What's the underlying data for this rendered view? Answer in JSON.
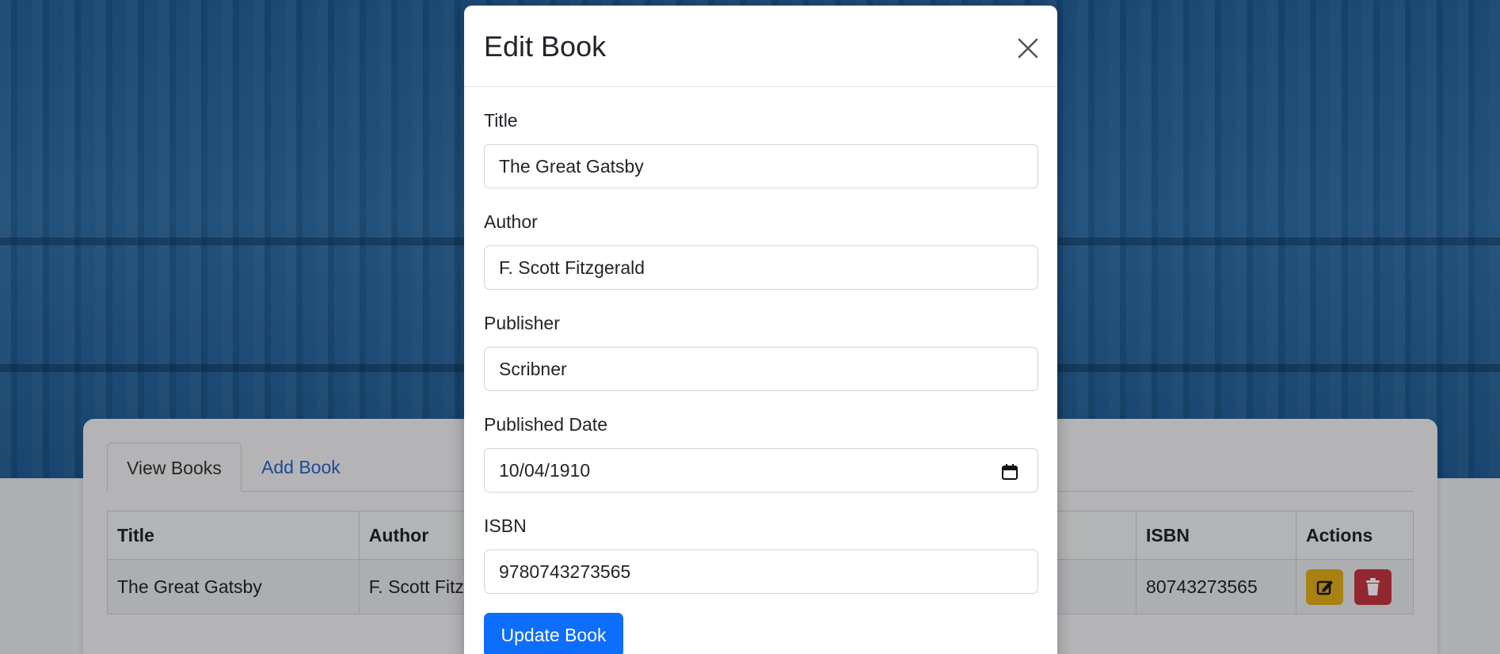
{
  "page": {
    "tabs": [
      {
        "label": "View Books"
      },
      {
        "label": "Add Book"
      }
    ],
    "table": {
      "headers": [
        "Title",
        "Author",
        "",
        "",
        "ISBN",
        "Actions"
      ],
      "rows": [
        {
          "title": "The Great Gatsby",
          "author": "F. Scott Fitz",
          "isbn_visible": "80743273565"
        }
      ]
    }
  },
  "modal": {
    "title": "Edit Book",
    "fields": {
      "title": {
        "label": "Title",
        "value": "The Great Gatsby"
      },
      "author": {
        "label": "Author",
        "value": "F. Scott Fitzgerald"
      },
      "publisher": {
        "label": "Publisher",
        "value": "Scribner"
      },
      "published_date": {
        "label": "Published Date",
        "value": "10/04/1910"
      },
      "isbn": {
        "label": "ISBN",
        "value": "9780743273565"
      }
    },
    "submit_label": "Update Book"
  },
  "icons": {
    "close": "close-icon",
    "calendar": "calendar-icon",
    "edit": "edit-icon",
    "delete": "trash-icon"
  },
  "colors": {
    "primary": "#0d6efd",
    "warning": "#e0ad1a",
    "danger": "#c5343f",
    "link": "#2763c5",
    "hero": "#1f5f98"
  }
}
